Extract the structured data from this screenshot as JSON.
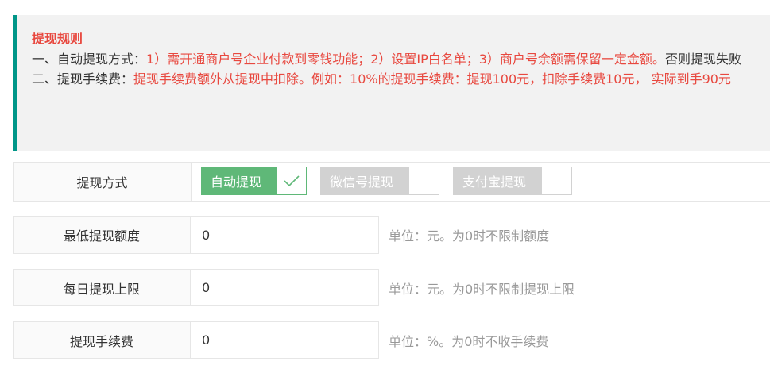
{
  "notice": {
    "title": "提现规则",
    "line1_label": "一、自动提现方式：",
    "line1_value": "1）需开通商户号企业付款到零钱功能；2）设置IP白名单；3）商户号余额需保留一定金额。",
    "line1_tail": "否则提现失败",
    "line2_label": "二、提现手续费：",
    "line2_value": "提现手续费额外从提现中扣除。例如：10%的提现手续费：提现100元，扣除手续费10元， 实际到手90元"
  },
  "form": {
    "method": {
      "label": "提现方式",
      "options": [
        {
          "label": "自动提现",
          "checked": true
        },
        {
          "label": "微信号提现",
          "checked": false
        },
        {
          "label": "支付宝提现",
          "checked": false
        }
      ]
    },
    "min_amount": {
      "label": "最低提现额度",
      "value": "0",
      "hint": "单位：元。为0时不限制额度"
    },
    "daily_limit": {
      "label": "每日提现上限",
      "value": "0",
      "hint": "单位：元。为0时不限制提现上限"
    },
    "fee": {
      "label": "提现手续费",
      "value": "0",
      "hint": "单位：%。为0时不收手续费"
    }
  },
  "colors": {
    "accent_green": "#5fb878",
    "notice_border": "#009688",
    "notice_red": "#e8483f",
    "disabled_gray": "#d2d2d2"
  },
  "icons": {
    "check": "checkmark-icon"
  }
}
